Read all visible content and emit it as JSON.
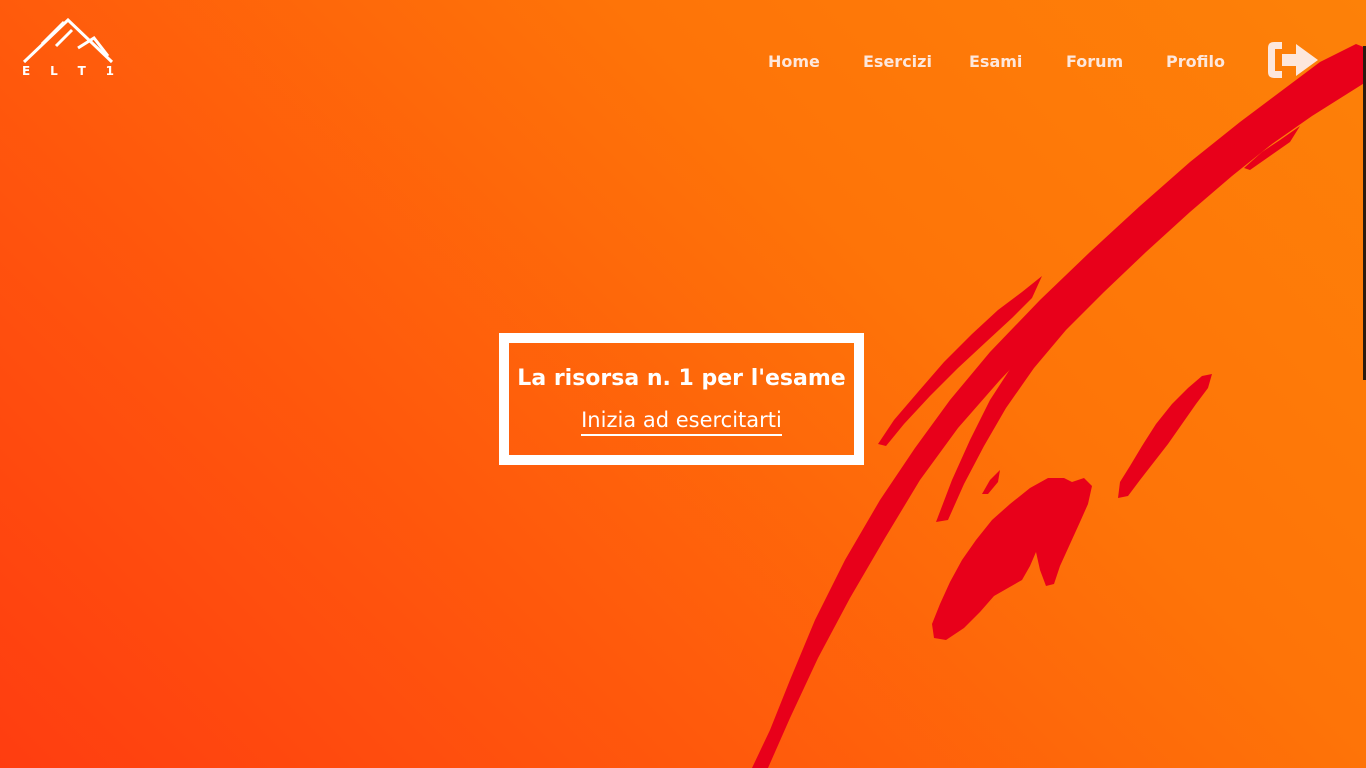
{
  "brand": {
    "logo_text": [
      "E",
      "L",
      "T",
      "1"
    ]
  },
  "nav": {
    "items": [
      {
        "label": "Home"
      },
      {
        "label": "Esercizi"
      },
      {
        "label": "Esami"
      },
      {
        "label": "Forum"
      },
      {
        "label": "Profilo"
      }
    ],
    "logout_icon": "sign-out-icon"
  },
  "hero": {
    "title": "La risorsa n. 1 per l'esame",
    "cta": "Inizia ad esercitarti"
  },
  "colors": {
    "gradient_start": "#ff3d10",
    "gradient_end": "#fd8108",
    "brush_stroke": "#e8001a",
    "text": "#ffffff",
    "nav_text": "#fde7dc"
  }
}
